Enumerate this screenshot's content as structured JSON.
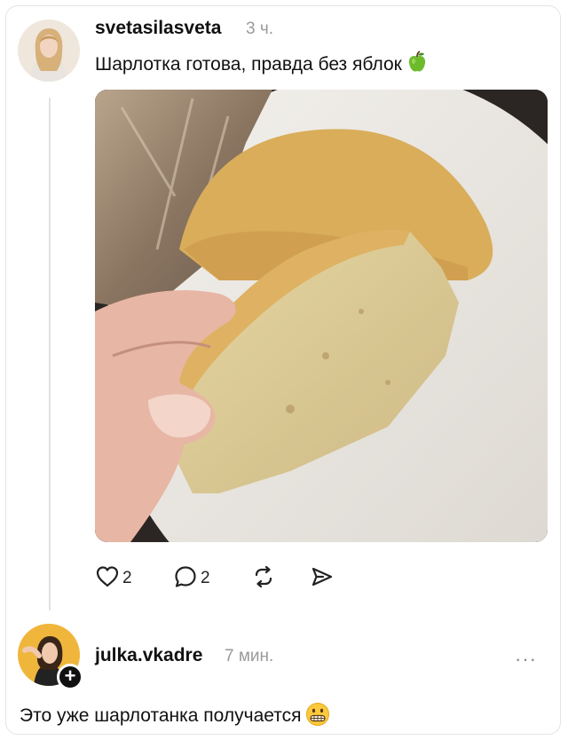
{
  "post": {
    "username": "svetasilasveta",
    "time": "3 ч.",
    "text": "Шарлотка готова, правда без яблок",
    "emoji": "green-apple",
    "likes": "2",
    "comments": "2"
  },
  "reply": {
    "username": "julka.vkadre",
    "time": "7 мин.",
    "text": "Это уже шарлотанка получается",
    "emoji": "grimacing-face",
    "more": "···"
  },
  "icons": [
    "heart-icon",
    "comment-icon",
    "repost-icon",
    "share-icon",
    "plus-icon",
    "more-icon"
  ]
}
